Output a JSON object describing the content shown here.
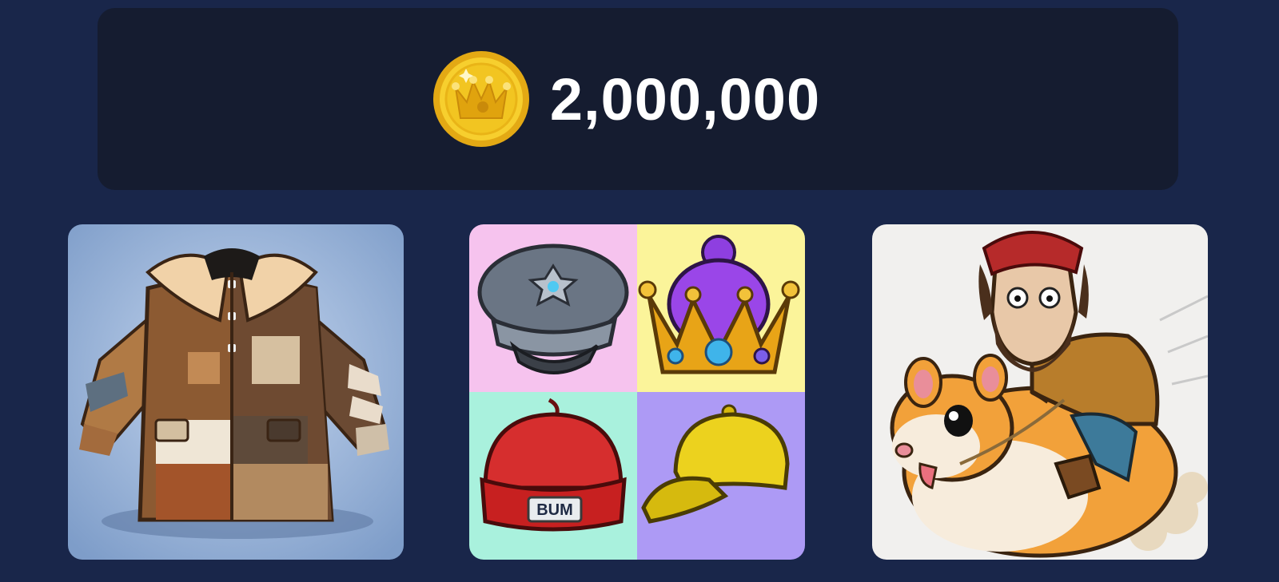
{
  "balance": {
    "amount": "2,000,000",
    "icon": "crown-coin-icon"
  },
  "cards": [
    {
      "icon": "fur-coat-icon"
    },
    {
      "icon": "hats-collection-icon",
      "badge_text": "BUM"
    },
    {
      "icon": "hamster-rider-icon"
    }
  ],
  "colors": {
    "background": "#19264a",
    "balance_card": "#151c30",
    "coin_gold": "#f2c521",
    "hat_panel_pink": "#f6c3ee",
    "hat_panel_yellow": "#fbf49a",
    "hat_panel_mint": "#a9f1dd",
    "hat_panel_violet": "#ad9af5"
  }
}
